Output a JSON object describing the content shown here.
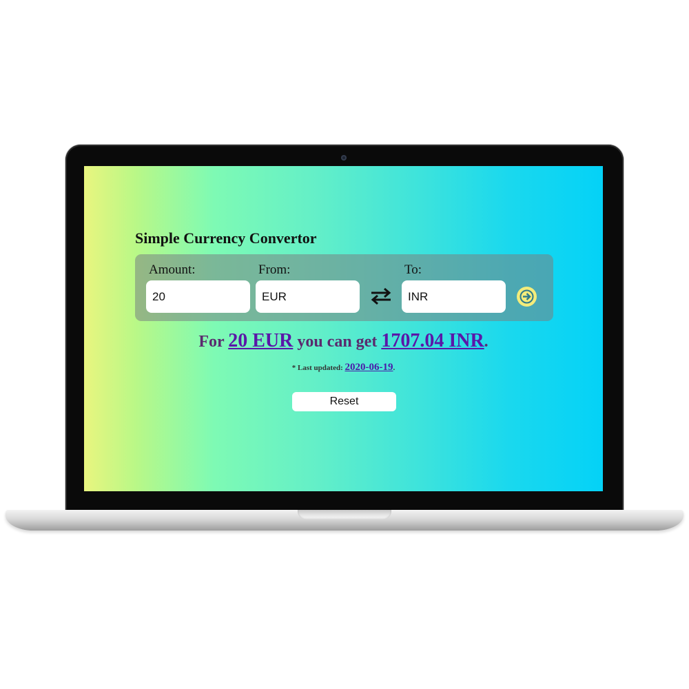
{
  "app": {
    "title": "Simple Currency Convertor",
    "amount_label": "Amount:",
    "from_label": "From:",
    "to_label": "To:",
    "amount_value": "20",
    "from_value": "EUR",
    "to_value": "INR",
    "swap_icon": "swap-arrows-icon",
    "convert_icon": "arrow-right-circle-icon"
  },
  "result": {
    "prefix": "For",
    "source": "20 EUR",
    "middle": "you can get",
    "target": "1707.04 INR",
    "suffix": "."
  },
  "updated": {
    "label": "* Last updated:",
    "date": "2020-06-19",
    "suffix": "."
  },
  "reset_label": "Reset",
  "colors": {
    "gradient_start": "#e9f57f",
    "gradient_end": "#04d2f7",
    "convert_button": "#f3ec7b",
    "link": "#5a17a8"
  }
}
